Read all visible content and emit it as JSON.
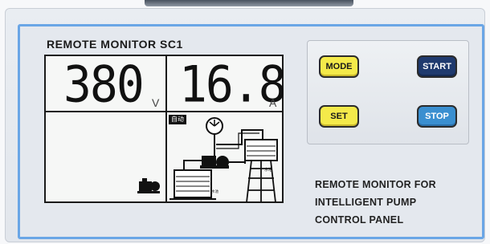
{
  "panel": {
    "title": "REMOTE MONITOR  SC1",
    "description": "REMOTE MONITOR FOR\nINTELLIGENT  PUMP\nCONTROL  PANEL"
  },
  "display": {
    "voltage": {
      "value": "380",
      "unit": "V"
    },
    "current": {
      "value": "16.8",
      "unit": "A"
    },
    "mode_tag": "自动"
  },
  "buttons": {
    "mode": "MODE",
    "start": "START",
    "set": "SET",
    "stop": "STOP"
  },
  "colors": {
    "frame": "#6aa6e6",
    "yellow_button": "#f4ea4a",
    "start_button": "#1f3a6e",
    "stop_button": "#3a8fd0"
  }
}
